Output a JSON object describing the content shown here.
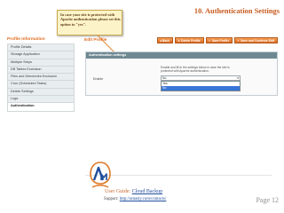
{
  "doc": {
    "title": "10. Authentication Settings",
    "callout": [
      "In case your site is protected with",
      "Apache authentication please set this",
      "option to \"yes\"."
    ]
  },
  "sidebar": {
    "title": "Profile Information",
    "items": [
      {
        "label": "Profile Details",
        "active": false
      },
      {
        "label": "Storage Application",
        "active": false
      },
      {
        "label": "Multiple Steps",
        "active": false
      },
      {
        "label": "DB Tables Exclusion",
        "active": false
      },
      {
        "label": "Files and Directories Exclusion",
        "active": false
      },
      {
        "label": "Cron (Scheduled Tasks)",
        "active": false
      },
      {
        "label": "Delete Settings",
        "active": false
      },
      {
        "label": "Logs",
        "active": false
      },
      {
        "label": "Authentication",
        "active": true
      }
    ]
  },
  "main": {
    "heading": "Edit Profile",
    "buttons": {
      "back": "Back",
      "delete": "Delete Profile",
      "save": "Save Profile",
      "save_continue": "Save and Continue Edit"
    },
    "section_title": "Authentication settings",
    "note": [
      "Enable and fill in the settings below in case the site is",
      "protected with Apache authentication."
    ],
    "enable_label": "Enable",
    "select_value": "No",
    "options": [
      "Yes",
      "No"
    ],
    "selected_option": "No"
  },
  "footer": {
    "guide_prefix": "User Guide: ",
    "guide_link": "Cloud Backup",
    "support_prefix": "Support: ",
    "support_link": "http://amasty.com/contacts/",
    "page": "Page 12"
  },
  "colors": {
    "accent": "#e06b1d",
    "section_header": "#6f8992",
    "option_selected": "#3875d7",
    "callout_bg": "#fdf3c9"
  },
  "icons": {
    "back": "arrow-left-icon",
    "delete": "delete-icon",
    "save": "save-icon",
    "save_continue": "save-continue-icon",
    "select": "chevron-down-icon"
  }
}
